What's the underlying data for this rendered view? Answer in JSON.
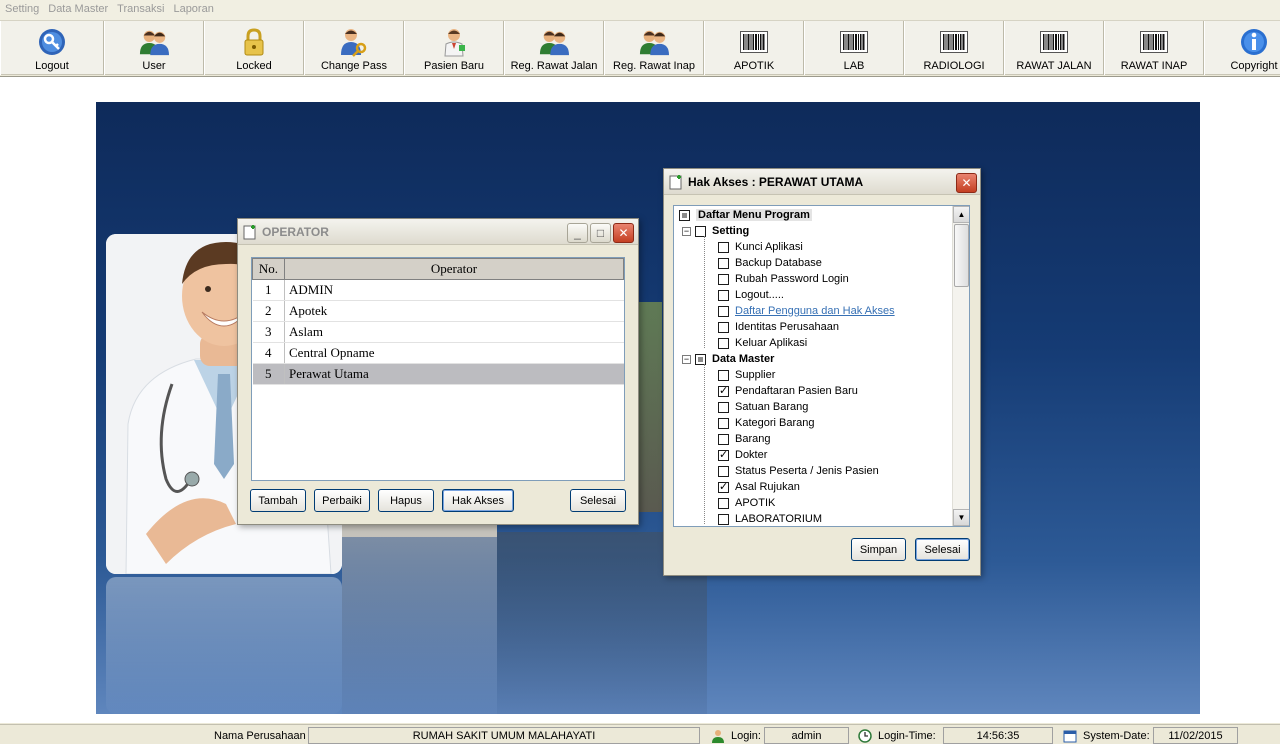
{
  "menubar": [
    "Setting",
    "Data Master",
    "Transaksi",
    "Laporan"
  ],
  "toolbar": [
    {
      "label": "Logout",
      "icon": "logout-icon"
    },
    {
      "label": "User",
      "icon": "users-icon"
    },
    {
      "label": "Locked",
      "icon": "lock-icon"
    },
    {
      "label": "Change Pass",
      "icon": "key-user-icon"
    },
    {
      "label": "Pasien Baru",
      "icon": "doctor-icon"
    },
    {
      "label": "Reg. Rawat Jalan",
      "icon": "users-icon"
    },
    {
      "label": "Reg. Rawat Inap",
      "icon": "users-icon"
    },
    {
      "label": "APOTIK",
      "icon": "barcode-icon"
    },
    {
      "label": "LAB",
      "icon": "barcode-icon"
    },
    {
      "label": "RADIOLOGI",
      "icon": "barcode-icon"
    },
    {
      "label": "RAWAT JALAN",
      "icon": "barcode-icon"
    },
    {
      "label": "RAWAT INAP",
      "icon": "barcode-icon"
    },
    {
      "label": "Copyright",
      "icon": "info-icon"
    }
  ],
  "operator": {
    "title": "OPERATOR",
    "col_no": "No.",
    "col_operator": "Operator",
    "rows": [
      {
        "no": "1",
        "name": "ADMIN"
      },
      {
        "no": "2",
        "name": "Apotek"
      },
      {
        "no": "3",
        "name": "Aslam"
      },
      {
        "no": "4",
        "name": "Central Opname"
      },
      {
        "no": "5",
        "name": "Perawat Utama"
      }
    ],
    "selected": "5",
    "buttons": {
      "tambah": "Tambah",
      "perbaiki": "Perbaiki",
      "hapus": "Hapus",
      "hak_akses": "Hak Akses",
      "selesai": "Selesai"
    }
  },
  "hak_akses": {
    "title": "Hak Akses : PERAWAT UTAMA",
    "root": "Daftar Menu Program",
    "groups": [
      {
        "label": "Setting",
        "state": "off",
        "items": [
          {
            "label": "Kunci Aplikasi",
            "checked": false
          },
          {
            "label": "Backup Database",
            "checked": false
          },
          {
            "label": "Rubah Password Login",
            "checked": false
          },
          {
            "label": "Logout.....",
            "checked": false
          },
          {
            "label": "Daftar Pengguna dan Hak Akses",
            "checked": false,
            "link": true
          },
          {
            "label": "Identitas Perusahaan",
            "checked": false
          },
          {
            "label": "Keluar Aplikasi",
            "checked": false
          }
        ]
      },
      {
        "label": "Data Master",
        "state": "partial",
        "items": [
          {
            "label": "Supplier",
            "checked": false
          },
          {
            "label": "Pendaftaran Pasien Baru",
            "checked": true
          },
          {
            "label": "Satuan Barang",
            "checked": false
          },
          {
            "label": "Kategori Barang",
            "checked": false
          },
          {
            "label": "Barang",
            "checked": false
          },
          {
            "label": "Dokter",
            "checked": true
          },
          {
            "label": "Status Peserta /  Jenis Pasien",
            "checked": false
          },
          {
            "label": "Asal Rujukan",
            "checked": true
          },
          {
            "label": "APOTIK",
            "checked": false
          },
          {
            "label": "LABORATORIUM",
            "checked": false
          }
        ]
      }
    ],
    "buttons": {
      "simpan": "Simpan",
      "selesai": "Selesai"
    }
  },
  "statusbar": {
    "company_label": "Nama Perusahaan",
    "company_value": "RUMAH SAKIT UMUM MALAHAYATI",
    "login_label": "Login:",
    "login_value": "admin",
    "login_time_label": "Login-Time:",
    "login_time_value": "14:56:35",
    "system_date_label": "System-Date:",
    "system_date_value": "11/02/2015"
  },
  "colors": {
    "banner_dark": "#0e2a5a",
    "banner_light": "#5f86bd",
    "selection": "#bcbcc0",
    "close_button": "#c43f22"
  }
}
